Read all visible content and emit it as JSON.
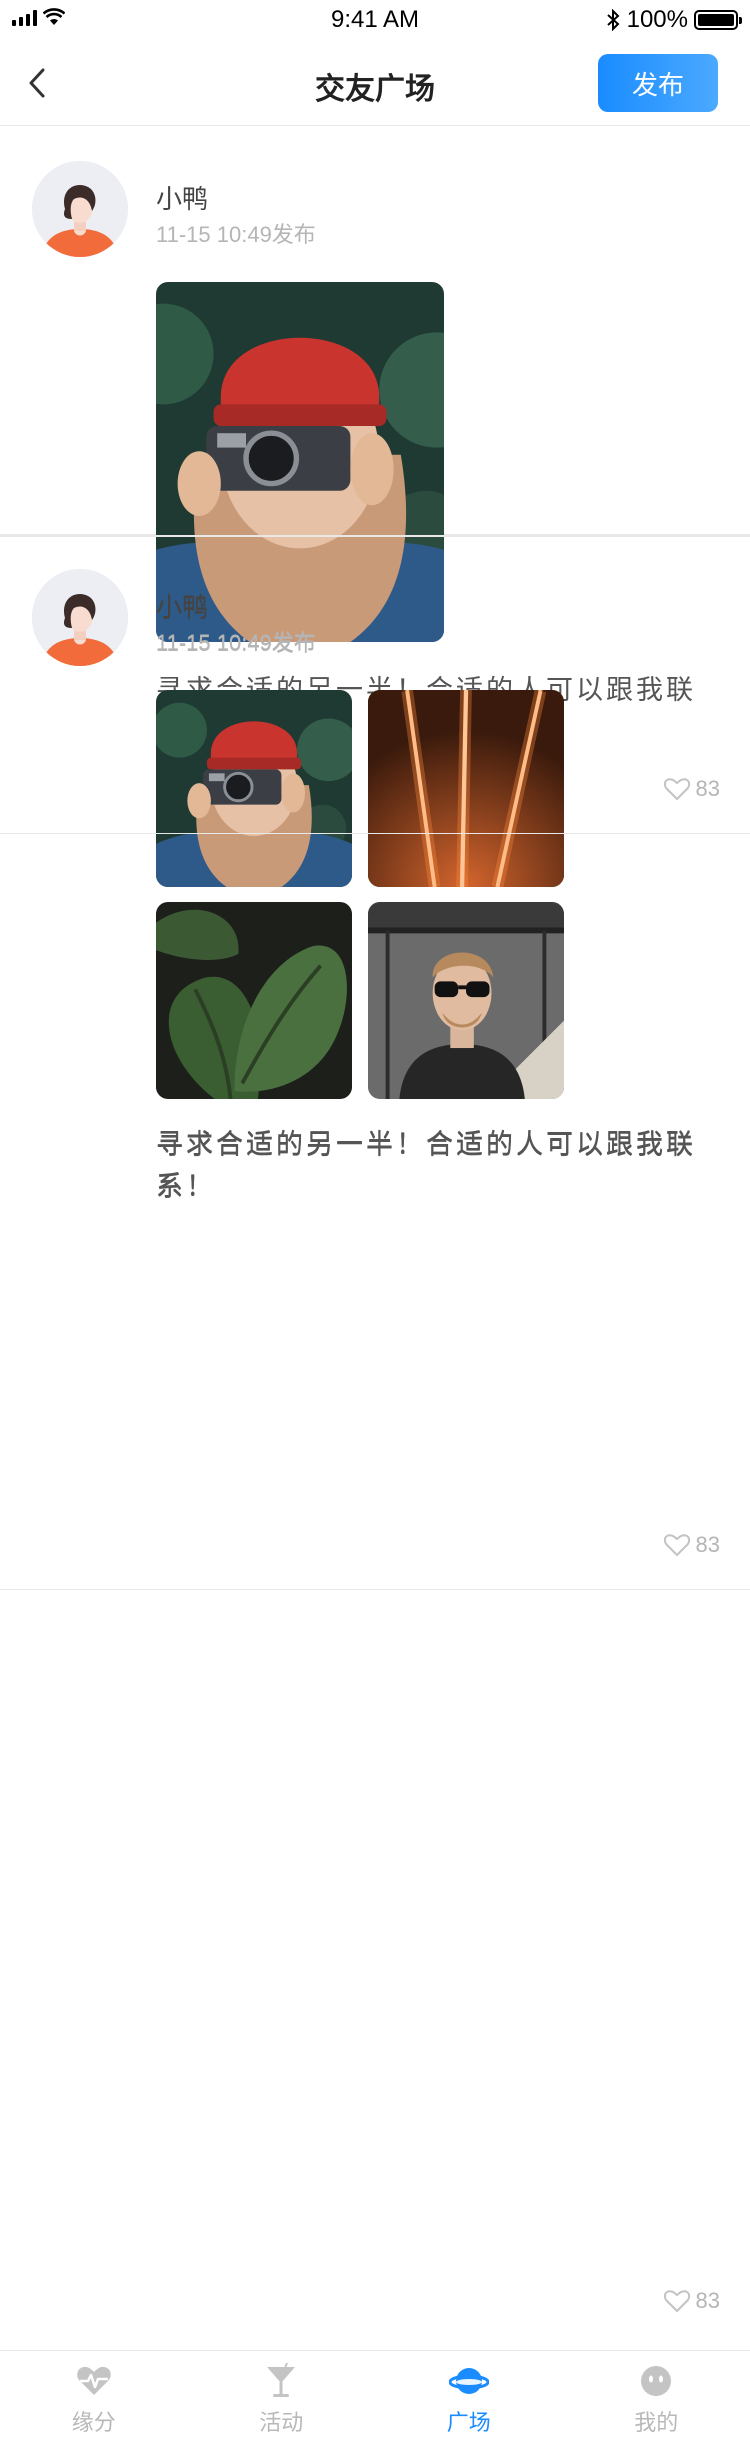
{
  "status_bar": {
    "time": "9:41 AM",
    "battery": "100%"
  },
  "nav": {
    "title": "交友广场",
    "publish_label": "发布"
  },
  "posts": [
    {
      "user": "小鸭",
      "time": "11-15  10:49发布",
      "text": "寻求合适的另一半！合适的人可以跟我联系！",
      "likes": "83"
    },
    {
      "user": "小鸭",
      "time": "11-15  10:49发布",
      "text": "寻求合适的另一半！合适的人可以跟我联系！",
      "likes": "83"
    },
    {
      "user": "小鸭",
      "time": "11-15  10:49发布",
      "text": "寻求合适的另一半！合适的人可以跟我联系！",
      "likes": "83"
    }
  ],
  "tabs": [
    {
      "label": "缘分",
      "icon": "heart-pulse-icon"
    },
    {
      "label": "活动",
      "icon": "cocktail-icon"
    },
    {
      "label": "广场",
      "icon": "planet-icon",
      "active": true
    },
    {
      "label": "我的",
      "icon": "face-icon"
    }
  ],
  "colors": {
    "accent": "#1a8cff",
    "divider": "#e8e8e8",
    "muted": "#b5b5b5"
  }
}
